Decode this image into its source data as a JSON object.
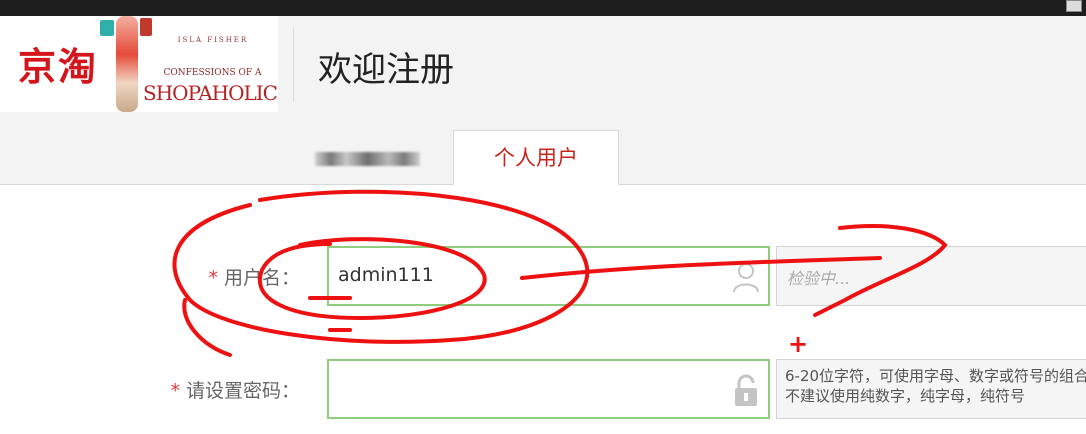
{
  "header": {
    "logo": {
      "brand_cn": "京淘",
      "poster_author": "ISLA FISHER",
      "poster_line": "",
      "poster_sub": "CONFESSIONS OF A",
      "poster_title": "SHOPAHOLIC"
    },
    "page_title": "欢迎注册"
  },
  "tabs": [
    {
      "label": "",
      "active": false,
      "blurred": true
    },
    {
      "label": "个人用户",
      "active": true
    }
  ],
  "form": {
    "username": {
      "required_mark": "*",
      "label": "用户名：",
      "value": "admin111",
      "icon": "user-icon",
      "hint_status": "检验中..."
    },
    "password": {
      "required_mark": "*",
      "label": "请设置密码：",
      "value": "",
      "icon": "lock-icon",
      "hint_line1": "6-20位字符，可使用字母、数字或符号的组合",
      "hint_line2": "不建议使用纯数字，纯字母，纯符号"
    }
  },
  "annotation": {
    "color": "#ee1111",
    "mark": "+"
  },
  "colors": {
    "accent_red": "#c8241e",
    "field_border_green": "#8fce7c",
    "required_star": "#e4393c"
  }
}
